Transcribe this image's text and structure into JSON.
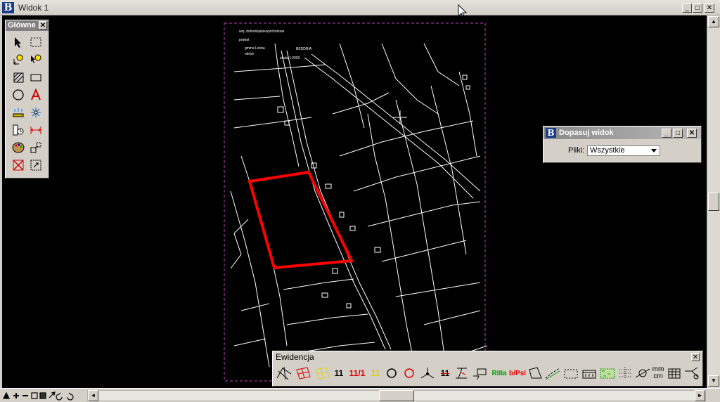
{
  "window": {
    "title": "Widok 1",
    "controls": {
      "minimize": "_",
      "maximize": "□",
      "close": "✕"
    }
  },
  "map": {
    "legend_lines": [
      "woj. dolnośląskie",
      "wyróżnienie",
      "powiat",
      "gmina Leśna",
      "obręb",
      "BEDDRIA",
      "skala 1:2000"
    ],
    "highlight_color": "#ff0000",
    "border_color": "#c040c0"
  },
  "glowne": {
    "title": "Główne",
    "close": "✕"
  },
  "dopasuj": {
    "title": "Dopasuj widok",
    "pliki_label": "Pliki:",
    "pliki_value": "Wszystkie",
    "controls": {
      "minimize": "_",
      "maximize": "□",
      "close": "✕"
    }
  },
  "ewidencja": {
    "title": "Ewidencja",
    "close": "✕",
    "tools": {
      "t4": "11",
      "t5": "11/1",
      "t6": "11",
      "t10": "11",
      "t13": "RIIIa",
      "t14": "b/PsI",
      "t23_top": "mm",
      "t23_bottom": "cm"
    }
  },
  "bottom": {
    "scroll_left": "◄",
    "scroll_right": "►"
  },
  "scroll": {
    "up": "▲",
    "down": "▼"
  }
}
